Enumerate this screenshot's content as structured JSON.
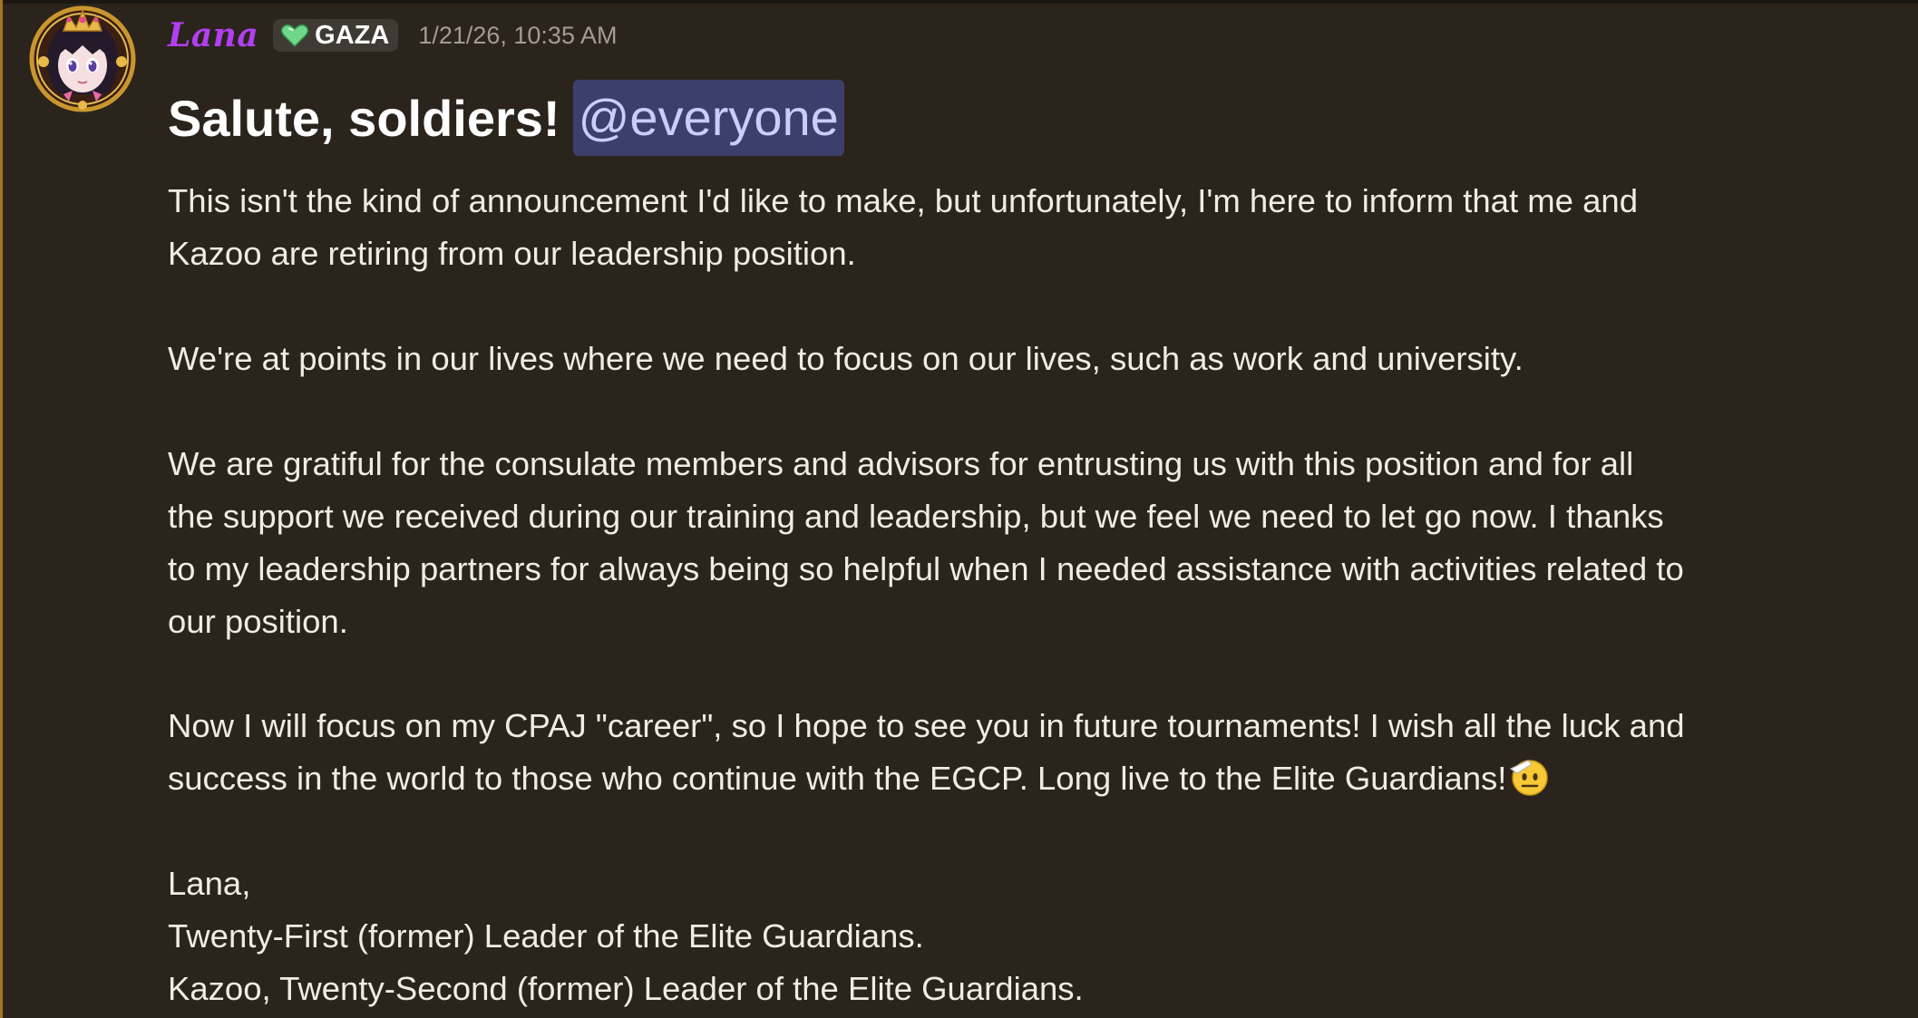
{
  "message": {
    "author": {
      "username": "Lana",
      "username_color": "#b23ff2",
      "avatar_icon": "anime-avatar-icon",
      "server_tag": {
        "icon": "green-heart-icon",
        "label": "GAZA"
      }
    },
    "timestamp": "1/21/26, 10:35 AM",
    "heading": "Salute, soldiers!",
    "mention": "@everyone",
    "mention_color": "#c9cdfb",
    "paragraphs": [
      [
        "This isn't the kind of announcement I'd like to make, but unfortunately, I'm here to inform that me and",
        "Kazoo are retiring from our leadership position."
      ],
      [
        "We're at points in our lives where we need to focus on our lives, such as work and university."
      ],
      [
        "We are gratiful for the consulate members and advisors for entrusting us with this position and for all",
        "the support we received during our training and leadership, but we feel we need to let go now. I thanks",
        "to my leadership partners for always being so helpful when I needed assistance with activities related to",
        "our position."
      ],
      [
        "Now I will focus on my CPAJ \"career\", so I hope to see you in future tournaments! I wish all the luck and",
        "success in the world to those who continue with the EGCP. Long live to the Elite Guardians!"
      ],
      [
        "Lana,",
        "Twenty-First (former) Leader of the Elite Guardians.",
        "Kazoo, Twenty-Second (former) Leader of the Elite Guardians."
      ]
    ],
    "trailing_emoji": "saluting-face-icon"
  },
  "colors": {
    "background": "#2a241d",
    "accent_bar": "#a8731e",
    "text": "#efece6",
    "timestamp": "#a49c92",
    "mention_bg": "#3c3f69",
    "tag_bg": "#3f3a33"
  }
}
